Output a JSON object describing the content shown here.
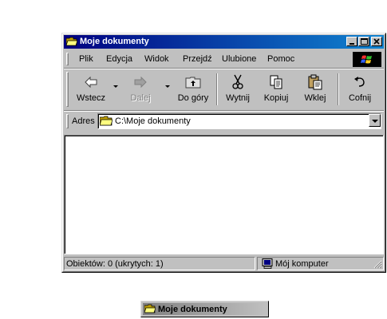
{
  "window": {
    "title": "Moje dokumenty",
    "icon": "folder-open-icon",
    "controls": [
      "minimize-icon",
      "maximize-icon",
      "close-icon"
    ]
  },
  "menu": {
    "items": [
      {
        "label": "Plik"
      },
      {
        "label": "Edycja"
      },
      {
        "label": "Widok"
      },
      {
        "label": "Przejdź"
      },
      {
        "label": "Ulubione"
      },
      {
        "label": "Pomoc"
      }
    ]
  },
  "toolbar": {
    "back_label": "Wstecz",
    "forward_label": "Dalej",
    "up_label": "Do góry",
    "cut_label": "Wytnij",
    "copy_label": "Kopiuj",
    "paste_label": "Wklej",
    "undo_label": "Cofnij"
  },
  "address": {
    "label": "Adres",
    "value": "C:\\Moje dokumenty"
  },
  "status": {
    "objects": "Obiektów: 0 (ukrytych: 1)",
    "location": "Mój komputer"
  },
  "minimized": {
    "title": "Moje dokumenty"
  },
  "colors": {
    "title_active_start": "#000080",
    "title_active_end": "#1084d0",
    "face": "#c0c0c0"
  }
}
